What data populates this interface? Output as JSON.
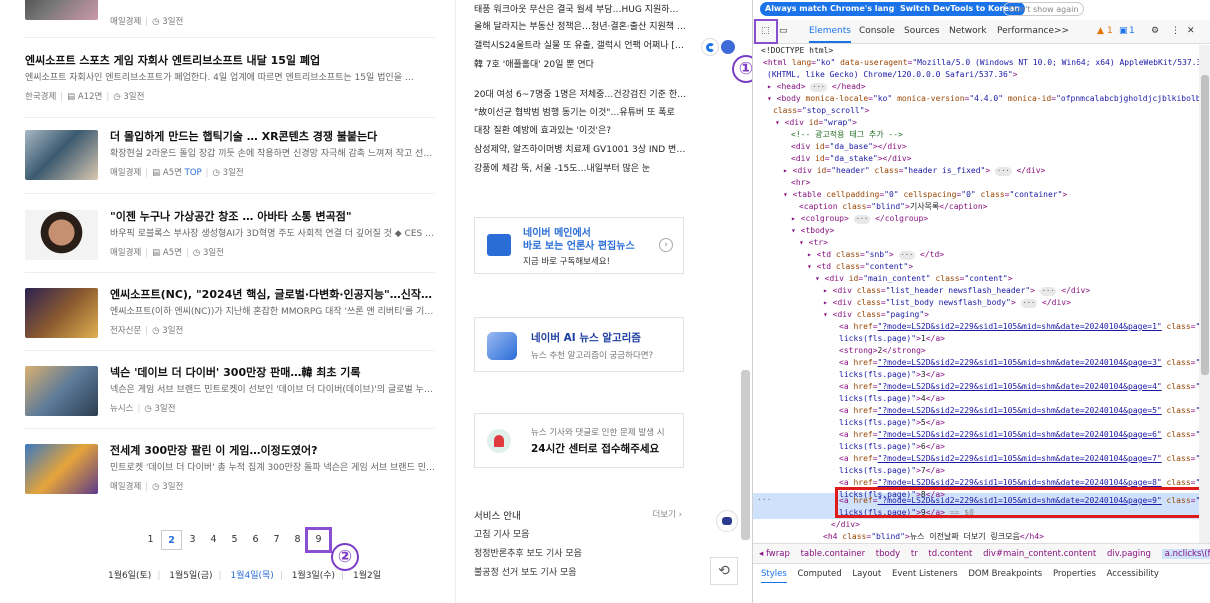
{
  "articles": [
    {
      "title": "",
      "desc": "",
      "meta": {
        "source": "매일경제",
        "date": "3일전"
      }
    },
    {
      "title": "엔씨소프트 스포츠 게임 자회사 엔트리브소프트 내달 15일 폐업",
      "desc": "엔씨소프트 자회사인 엔트리브소프트가 폐업한다. 4일 업계에 따르면 엔트리브소프트는 15일 법인을 …",
      "meta": {
        "source": "한국경제",
        "page": "A12면",
        "date": "3일전"
      }
    },
    {
      "title": "더 몰입하게 만드는 햅틱기술 … XR콘텐츠 경쟁 불붙는다",
      "desc": "확장현실 2라운드 돌입 장갑 끼듯 손에 착용하면 신경망 자극해 감촉 느껴져 작고 선…",
      "meta": {
        "source": "매일경제",
        "page": "A5면",
        "top": "TOP",
        "date": "3일전"
      }
    },
    {
      "title": "\"이젠 누구나 가상공간 창조 … 아바타 소통 변곡점\"",
      "desc": "바우픽 로블록스 부사장 생성형AI가 3D혁명 주도 사회적 연결 더 깊어질 것 ◆ CES 2024…",
      "meta": {
        "source": "매일경제",
        "page": "A5면",
        "date": "3일전"
      }
    },
    {
      "title": "엔씨소프트(NC), \"2024년 핵심, 글로벌·다변화·인공지능\"…신작IP·AI 등 청…",
      "desc": "엔씨소프트(이하 엔씨(NC))가 지난해 혼잡한 MMORPG 대작 '쓰론 앤 리버티'를 기점으…",
      "meta": {
        "source": "전자신문",
        "date": "3일전"
      }
    },
    {
      "title": "넥슨 '데이브 더 다이버' 300만장 판매…韓 최초 기록",
      "desc": "넥슨은 게임 서브 브랜드 민트로켓이 선보인 '데이브 더 다이버(데이브)'의 글로벌 누적 …",
      "meta": {
        "source": "뉴시스",
        "date": "3일전"
      }
    },
    {
      "title": "전세계 300만장 팔린 이 게임…이정도였어?",
      "desc": "민트로켓 '데이브 더 다이버' 총 누적 집계 300만장 돌파 넥슨은 게임 서브 브랜드 민트…",
      "meta": {
        "source": "매일경제",
        "date": "3일전"
      }
    }
  ],
  "pager": {
    "pages": [
      "1",
      "2",
      "3",
      "4",
      "5",
      "6",
      "7",
      "8",
      "9"
    ],
    "current": "2"
  },
  "dates": [
    "1월6일(토)",
    "1월5일(금)",
    "1월4일(목)",
    "1월3일(수)",
    "1월2일"
  ],
  "markers": {
    "one": "①",
    "two": "②"
  },
  "headlines_top": [
    "태풍 워크아웃 무산은 결국 월세 부담…HUG 지원하…",
    "올해 달라지는 부동산 정책은…청년·결혼·출산 지원책 …",
    "갤럭시S24울트라 실물 또 유출, 갤럭시 언팩 어쩌나 [1…",
    "韓 7호 '애플홀대' 20일 뿐 연다"
  ],
  "headlines_bottom": [
    "20대 여성 6~7명중 1명은 저체중…건강검진 기준 한국…",
    "\"故이선균 협박범 범행 동기는 이것\"…유튜버 또 폭로",
    "대장 질환 예방에 효과있는 '이것'은?",
    "삼성제약, 알즈하이머병 치료제 GV1001 3상 IND 변경 …",
    "강풍에 체감 뚝, 서울 -15도…내일부터 많은 눈"
  ],
  "banners": {
    "main": {
      "line1": "네이버 메인에서",
      "line2": "바로 보는 언론사 편집뉴스",
      "sub": "지금 바로 구독해보세요!"
    },
    "ai": {
      "title": "네이버 AI 뉴스 알고리즘",
      "sub": "뉴스 추천 알고리즘이 궁금하다면?"
    },
    "center": {
      "sub": "뉴스 기사와 댓글로 인한 문제 발생 시",
      "title": "24시간 센터로 접수해주세요"
    }
  },
  "services": {
    "title": "서비스 안내",
    "more": "더보기 ›",
    "items": [
      "고침 기사 모음",
      "정정반론추후 보도 기사 모음",
      "불공정 선거 보도 기사 모음"
    ]
  },
  "devtools": {
    "lang_match": "Always match Chrome's language",
    "lang_switch": "Switch DevTools to Korean",
    "lang_dismiss": "Don't show again",
    "tabs": [
      "Elements",
      "Console",
      "Sources",
      "Network",
      "Performance",
      ">>"
    ],
    "warn_count": "1",
    "msg_count": "1",
    "crumbs": [
      "◂ fwrap",
      "table.container",
      "tbody",
      "tr",
      "td.content",
      "div#main_content.content",
      "div.paging",
      "a.nclicks\\(fls\\.page\\)"
    ],
    "sub_tabs": [
      "Styles",
      "Computed",
      "Layout",
      "Event Listeners",
      "DOM Breakpoints",
      "Properties",
      "Accessibility"
    ]
  }
}
